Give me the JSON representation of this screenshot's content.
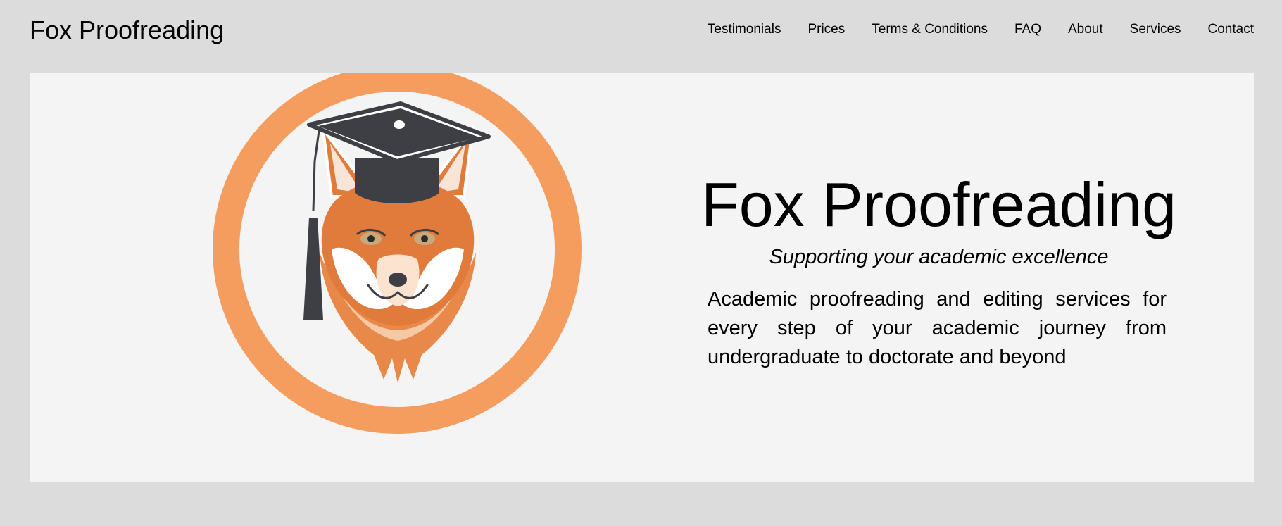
{
  "header": {
    "site_title": "Fox Proofreading",
    "nav": [
      {
        "label": "Testimonials"
      },
      {
        "label": "Prices"
      },
      {
        "label": "Terms & Conditions"
      },
      {
        "label": "FAQ"
      },
      {
        "label": "About"
      },
      {
        "label": "Services"
      },
      {
        "label": "Contact"
      }
    ]
  },
  "hero": {
    "logo_icon": "fox-with-graduation-cap-icon",
    "heading": "Fox Proofreading",
    "tagline": "Supporting your academic excellence",
    "description": "Academic proofreading and editing services for every step of your academic journey from undergraduate to doctorate and beyond"
  },
  "colors": {
    "page_background": "#dcdcdc",
    "hero_background": "#f4f4f4",
    "ring_orange": "#f49d5e",
    "fox_orange": "#e07b3c",
    "cap_dark": "#3d3f45"
  }
}
